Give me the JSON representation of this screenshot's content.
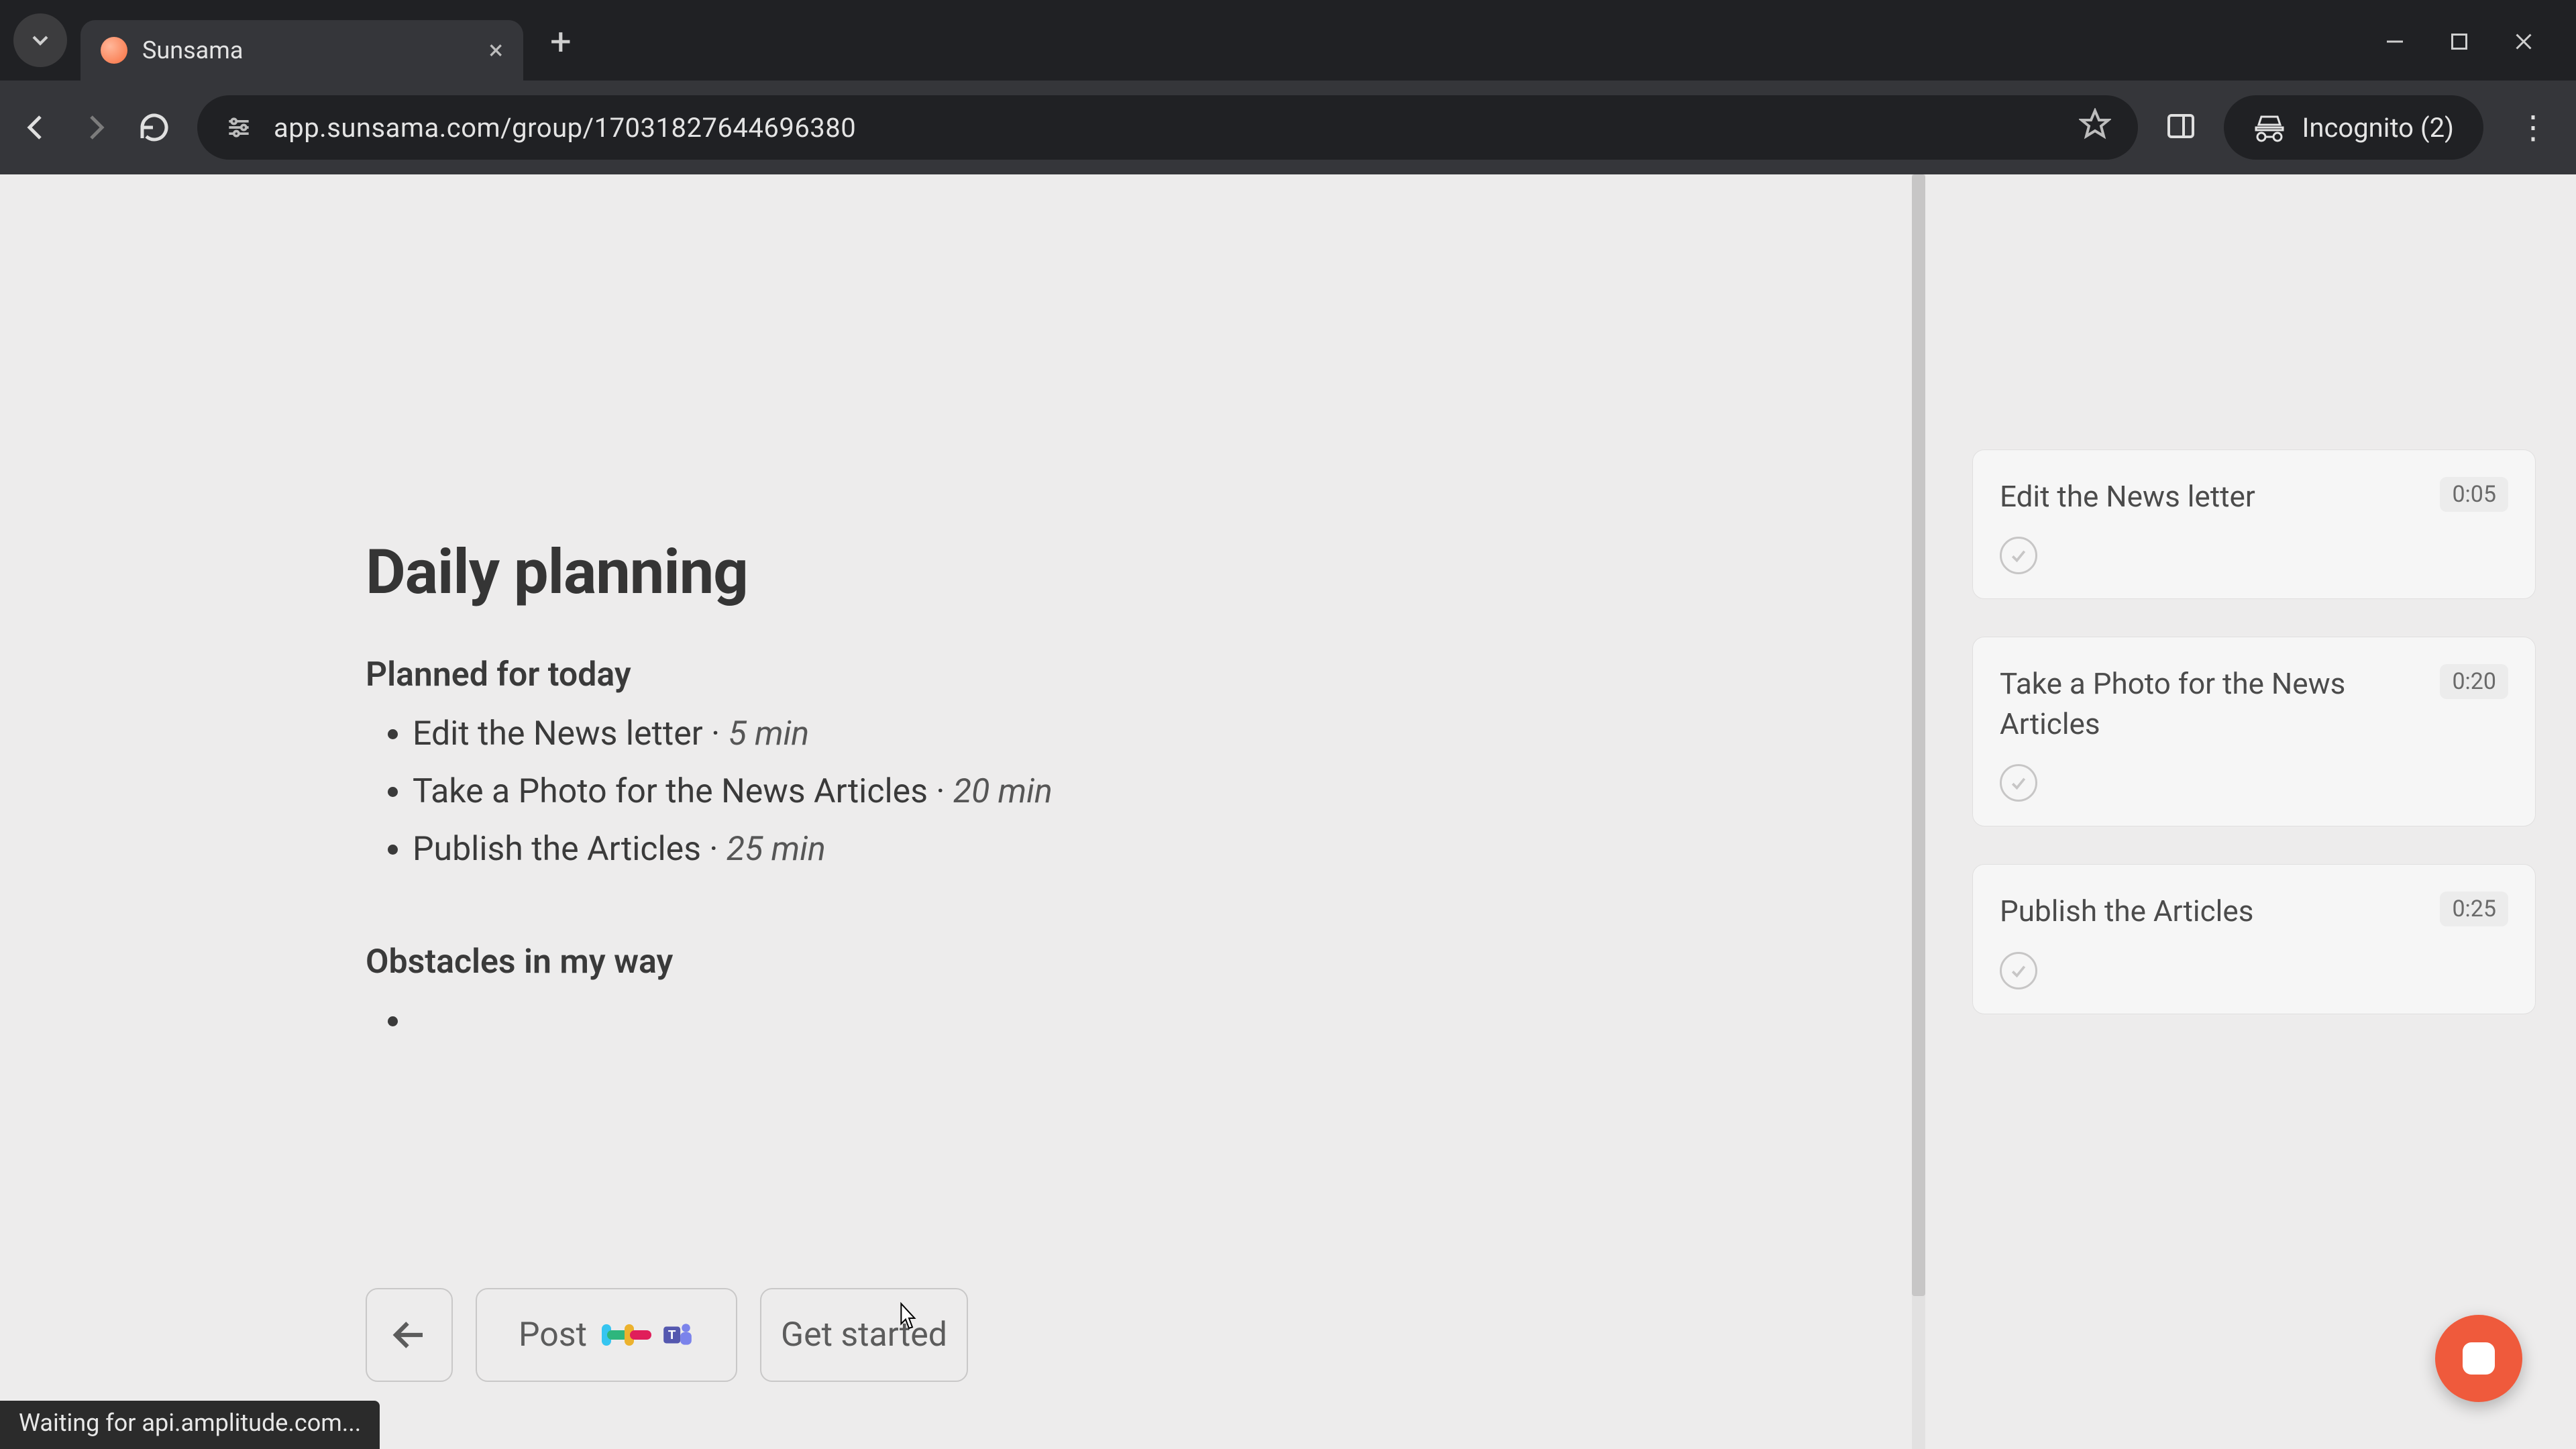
{
  "browser": {
    "tab_title": "Sunsama",
    "url": "app.sunsama.com/group/17031827644696380",
    "incognito_label": "Incognito (2)"
  },
  "main": {
    "heading": "Daily planning",
    "planned_label": "Planned for today",
    "planned": [
      {
        "title": "Edit the News letter",
        "duration": "5 min"
      },
      {
        "title": "Take a Photo for the News Articles",
        "duration": "20 min"
      },
      {
        "title": "Publish the Articles",
        "duration": "25 min"
      }
    ],
    "obstacles_label": "Obstacles in my way",
    "obstacles": [
      ""
    ],
    "buttons": {
      "post_label": "Post",
      "get_started_label": "Get started"
    }
  },
  "sidebar": {
    "tasks": [
      {
        "title": "Edit the News letter",
        "time": "0:05"
      },
      {
        "title": "Take a Photo for the News Articles",
        "time": "0:20"
      },
      {
        "title": "Publish the Articles",
        "time": "0:25"
      }
    ]
  },
  "status_bar": "Waiting for api.amplitude.com...",
  "colors": {
    "accent": "#ef5a3c"
  }
}
